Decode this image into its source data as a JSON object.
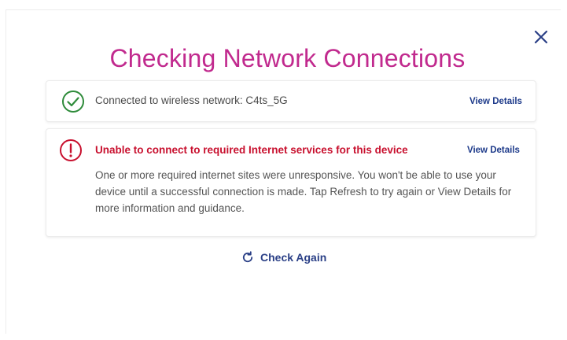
{
  "dialog": {
    "title": "Checking Network Connections",
    "close_icon": "close-icon"
  },
  "connection": {
    "status_icon": "check-circle-icon",
    "text": "Connected to wireless network: C4ts_5G",
    "details_link": "View Details"
  },
  "services": {
    "status_icon": "alert-circle-icon",
    "heading": "Unable to connect to required Internet services for this device",
    "body": "One or more required internet sites were unresponsive. You won't be able to use your device until a successful connection is made. Tap Refresh to try again or View Details for more information and guidance.",
    "details_link": "View Details"
  },
  "actions": {
    "check_again_icon": "refresh-icon",
    "check_again_label": "Check Again"
  },
  "colors": {
    "title": "#c12a8e",
    "success": "#2e8b3a",
    "error": "#c8102e",
    "link": "#1d3a8a",
    "close": "#2a3f86"
  }
}
